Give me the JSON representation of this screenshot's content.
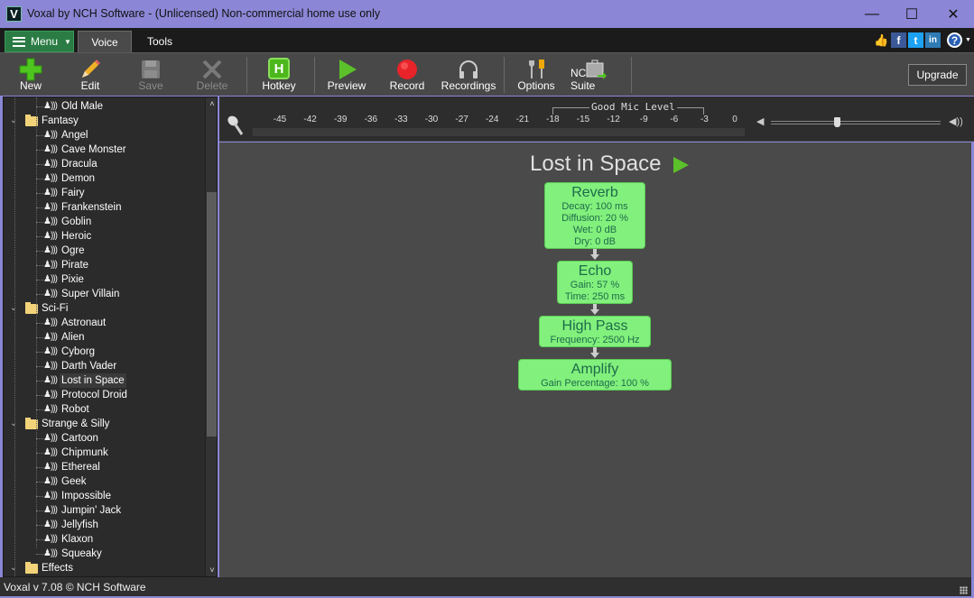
{
  "window": {
    "title": "Voxal by NCH Software - (Unlicensed) Non-commercial home use only",
    "app_icon_letter": "V",
    "controls": {
      "minimize": "—",
      "maximize": "☐",
      "close": "✕"
    }
  },
  "tabbar": {
    "menu_label": "Menu",
    "tabs": [
      {
        "label": "Voice",
        "active": true
      },
      {
        "label": "Tools",
        "active": false
      }
    ],
    "social": {
      "like": "👍",
      "facebook": "f",
      "twitter": "t",
      "linkedin": "in",
      "help": "?"
    }
  },
  "toolbar": {
    "buttons": [
      {
        "label": "New",
        "enabled": true
      },
      {
        "label": "Edit",
        "enabled": true
      },
      {
        "label": "Save",
        "enabled": false
      },
      {
        "label": "Delete",
        "enabled": false
      },
      {
        "label": "Hotkey",
        "enabled": true
      },
      {
        "label": "Preview",
        "enabled": true
      },
      {
        "label": "Record",
        "enabled": true
      },
      {
        "label": "Recordings",
        "enabled": true
      },
      {
        "label": "Options",
        "enabled": true
      },
      {
        "label": "NCH Suite",
        "enabled": true
      }
    ],
    "hotkey_letter": "H",
    "upgrade_label": "Upgrade"
  },
  "sidebar": {
    "rows": [
      {
        "type": "item",
        "label": "Old Male"
      },
      {
        "type": "category",
        "label": "Fantasy"
      },
      {
        "type": "item",
        "label": "Angel"
      },
      {
        "type": "item",
        "label": "Cave Monster"
      },
      {
        "type": "item",
        "label": "Dracula"
      },
      {
        "type": "item",
        "label": "Demon"
      },
      {
        "type": "item",
        "label": "Fairy"
      },
      {
        "type": "item",
        "label": "Frankenstein"
      },
      {
        "type": "item",
        "label": "Goblin"
      },
      {
        "type": "item",
        "label": "Heroic"
      },
      {
        "type": "item",
        "label": "Ogre"
      },
      {
        "type": "item",
        "label": "Pirate"
      },
      {
        "type": "item",
        "label": "Pixie"
      },
      {
        "type": "item",
        "label": "Super Villain"
      },
      {
        "type": "category",
        "label": "Sci-Fi"
      },
      {
        "type": "item",
        "label": "Astronaut"
      },
      {
        "type": "item",
        "label": "Alien"
      },
      {
        "type": "item",
        "label": "Cyborg"
      },
      {
        "type": "item",
        "label": "Darth Vader"
      },
      {
        "type": "item",
        "label": "Lost in Space",
        "selected": true
      },
      {
        "type": "item",
        "label": "Protocol Droid"
      },
      {
        "type": "item",
        "label": "Robot"
      },
      {
        "type": "category",
        "label": "Strange & Silly"
      },
      {
        "type": "item",
        "label": "Cartoon"
      },
      {
        "type": "item",
        "label": "Chipmunk"
      },
      {
        "type": "item",
        "label": "Ethereal"
      },
      {
        "type": "item",
        "label": "Geek"
      },
      {
        "type": "item",
        "label": "Impossible"
      },
      {
        "type": "item",
        "label": "Jumpin' Jack"
      },
      {
        "type": "item",
        "label": "Jellyfish"
      },
      {
        "type": "item",
        "label": "Klaxon"
      },
      {
        "type": "item",
        "label": "Squeaky"
      },
      {
        "type": "category",
        "label": "Effects"
      }
    ],
    "scroll_up": "˄",
    "scroll_down": "˅",
    "scroll_thumb_start_fraction": 0.18,
    "scroll_thumb_end_fraction": 0.72
  },
  "meter": {
    "ticks": [
      "-45",
      "-42",
      "-39",
      "-36",
      "-33",
      "-30",
      "-27",
      "-24",
      "-21",
      "-18",
      "-15",
      "-12",
      "-9",
      "-6",
      "-3",
      "0"
    ],
    "good_level_label": "Good Mic Level",
    "good_level_range": [
      "-18",
      "-3"
    ],
    "volume_fraction": 0.39
  },
  "preset": {
    "title": "Lost in Space",
    "effects": [
      {
        "name": "Reverb",
        "params": [
          "Decay: 100 ms",
          "Diffusion: 20 %",
          "Wet: 0 dB",
          "Dry: 0 dB"
        ]
      },
      {
        "name": "Echo",
        "params": [
          "Gain: 57 %",
          "Time: 250 ms"
        ]
      },
      {
        "name": "High Pass",
        "params": [
          "Frequency: 2500 Hz"
        ]
      },
      {
        "name": "Amplify",
        "params": [
          "Gain Percentage: 100 %"
        ]
      }
    ]
  },
  "status": {
    "text": "Voxal v 7.08 © NCH Software"
  },
  "colors": {
    "accent_green": "#2a7c44",
    "effect_fill": "#82f07c",
    "effect_text": "#1d6c4a",
    "title_bar": "#8b87d6"
  }
}
